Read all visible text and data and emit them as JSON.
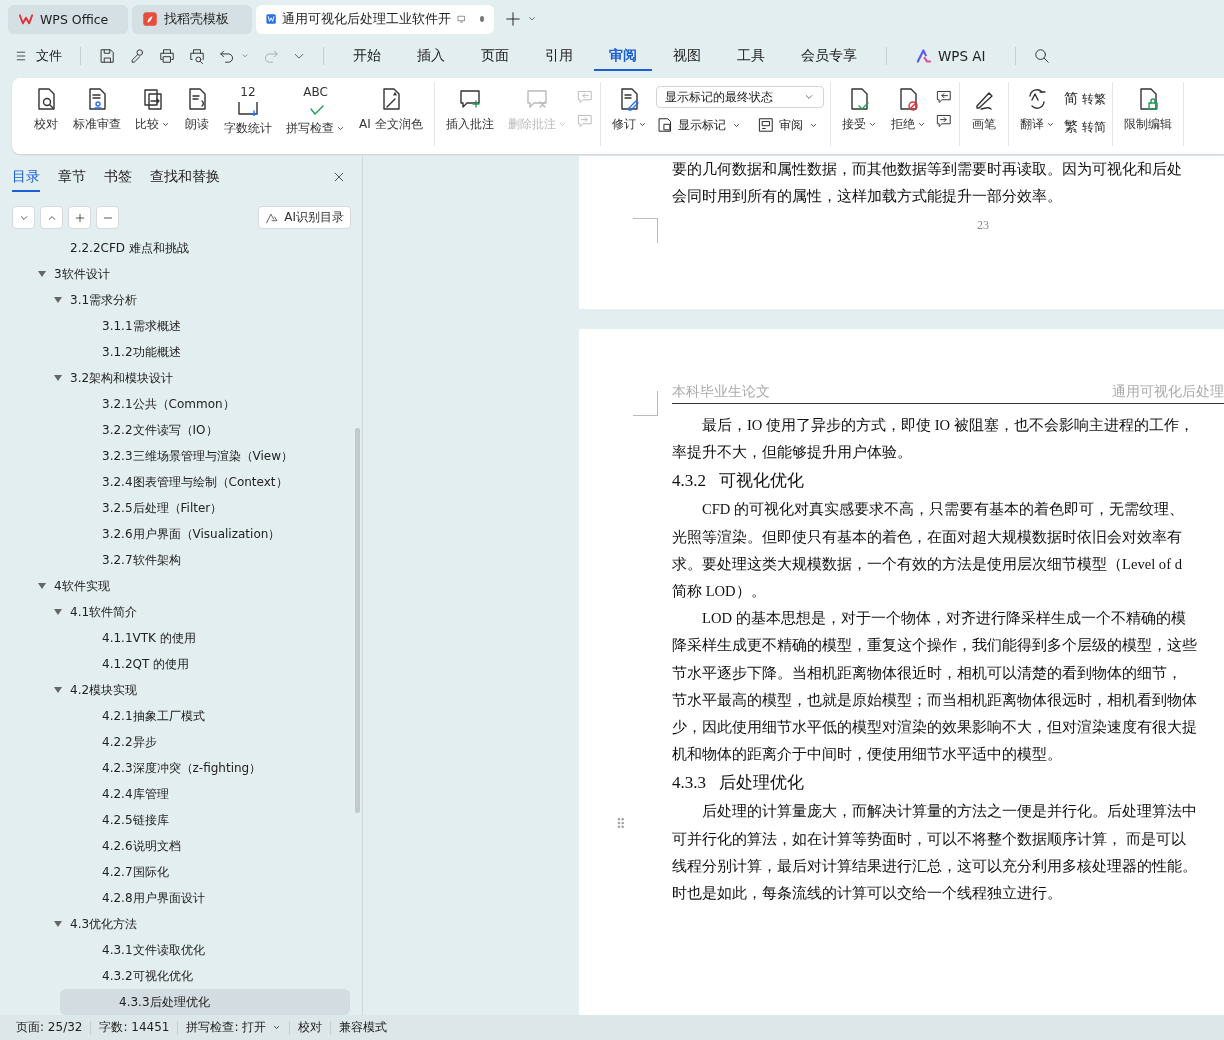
{
  "tabs": [
    {
      "label": "WPS Office",
      "selected": false
    },
    {
      "label": "找稻壳模板",
      "selected": false
    },
    {
      "label": "通用可视化后处理工业软件开",
      "selected": true,
      "unsaved": true
    }
  ],
  "menu": {
    "file": "文件",
    "tabs": [
      {
        "label": "开始",
        "selected": false
      },
      {
        "label": "插入",
        "selected": false
      },
      {
        "label": "页面",
        "selected": false
      },
      {
        "label": "引用",
        "selected": false
      },
      {
        "label": "审阅",
        "selected": true
      },
      {
        "label": "视图",
        "selected": false
      },
      {
        "label": "工具",
        "selected": false
      },
      {
        "label": "会员专享",
        "selected": false
      }
    ],
    "ai": "WPS AI"
  },
  "ribbon": [
    {
      "items": [
        {
          "kind": "large",
          "label": "校对",
          "dropdown": false,
          "disabled": false
        },
        {
          "kind": "large",
          "label": "标准审查",
          "dropdown": false,
          "disabled": false
        },
        {
          "kind": "large",
          "label": "比较",
          "dropdown": true,
          "disabled": false
        },
        {
          "kind": "large",
          "label": "朗读",
          "dropdown": false,
          "disabled": false
        },
        {
          "kind": "large",
          "label": "字数统计",
          "icon_text": "12",
          "dropdown": false,
          "disabled": false
        },
        {
          "kind": "large",
          "label": "拼写检查",
          "icon_text": "ABC",
          "dropdown": true,
          "disabled": false
        },
        {
          "kind": "large",
          "label": "AI 全文润色",
          "dropdown": false,
          "disabled": false
        }
      ]
    },
    {
      "items": [
        {
          "kind": "large",
          "label": "插入批注",
          "dropdown": false,
          "disabled": false
        },
        {
          "kind": "large",
          "label": "删除批注",
          "dropdown": true,
          "disabled": true
        },
        {
          "kind": "icon-pair",
          "disabled": true
        }
      ]
    },
    {
      "items": [
        {
          "kind": "large",
          "label": "修订",
          "dropdown": true,
          "disabled": false
        },
        {
          "kind": "select",
          "value": "显示标记的最终状态",
          "buttons": [
            {
              "label": "显示标记",
              "dropdown": true
            },
            {
              "label": "审阅",
              "dropdown": true
            }
          ]
        }
      ]
    },
    {
      "items": [
        {
          "kind": "large",
          "label": "接受",
          "dropdown": true,
          "disabled": false
        },
        {
          "kind": "large",
          "label": "拒绝",
          "dropdown": true,
          "disabled": false
        },
        {
          "kind": "icon-pair",
          "disabled": false
        }
      ]
    },
    {
      "items": [
        {
          "kind": "large",
          "label": "画笔",
          "dropdown": false,
          "disabled": false
        }
      ]
    },
    {
      "items": [
        {
          "kind": "large",
          "label": "翻译",
          "dropdown": true,
          "disabled": false
        },
        {
          "kind": "small-pair",
          "buttons": [
            {
              "glyph": "简",
              "label": "转繁"
            },
            {
              "glyph": "繁",
              "label": "转简"
            }
          ]
        }
      ]
    },
    {
      "items": [
        {
          "kind": "large",
          "label": "限制编辑",
          "dropdown": false,
          "disabled": false
        }
      ]
    }
  ],
  "sidebar": {
    "tabs": [
      {
        "label": "目录",
        "selected": true
      },
      {
        "label": "章节",
        "selected": false
      },
      {
        "label": "书签",
        "selected": false
      },
      {
        "label": "查找和替换",
        "selected": false
      }
    ],
    "ai_button": "AI识别目录",
    "toc": [
      {
        "label": "2.2.2CFD 难点和挑战",
        "selected": false
      },
      {
        "label": "3软件设计",
        "expanded": true,
        "selected": false,
        "children": [
          {
            "label": "3.1需求分析",
            "expanded": true,
            "selected": false,
            "children": [
              {
                "label": "3.1.1需求概述",
                "selected": false
              },
              {
                "label": "3.1.2功能概述",
                "selected": false
              }
            ]
          },
          {
            "label": "3.2架构和模块设计",
            "expanded": true,
            "selected": false,
            "children": [
              {
                "label": "3.2.1公共（Common）",
                "selected": false
              },
              {
                "label": "3.2.2文件读写（IO）",
                "selected": false
              },
              {
                "label": "3.2.3三维场景管理与渲染（View）",
                "selected": false
              },
              {
                "label": "3.2.4图表管理与绘制（Context）",
                "selected": false
              },
              {
                "label": "3.2.5后处理（Filter）",
                "selected": false
              },
              {
                "label": "3.2.6用户界面（Visualization）",
                "selected": false
              },
              {
                "label": "3.2.7软件架构",
                "selected": false
              }
            ]
          }
        ]
      },
      {
        "label": "4软件实现",
        "expanded": true,
        "selected": false,
        "children": [
          {
            "label": "4.1软件简介",
            "expanded": true,
            "selected": false,
            "children": [
              {
                "label": "4.1.1VTK 的使用",
                "selected": false
              },
              {
                "label": "4.1.2QT 的使用",
                "selected": false
              }
            ]
          },
          {
            "label": "4.2模块实现",
            "expanded": true,
            "selected": false,
            "children": [
              {
                "label": "4.2.1抽象工厂模式",
                "selected": false
              },
              {
                "label": "4.2.2异步",
                "selected": false
              },
              {
                "label": "4.2.3深度冲突（z-fighting）",
                "selected": false
              },
              {
                "label": "4.2.4库管理",
                "selected": false
              },
              {
                "label": "4.2.5链接库",
                "selected": false
              },
              {
                "label": "4.2.6说明文档",
                "selected": false
              },
              {
                "label": "4.2.7国际化",
                "selected": false
              },
              {
                "label": "4.2.8用户界面设计",
                "selected": false
              }
            ]
          },
          {
            "label": "4.3优化方法",
            "expanded": true,
            "selected": false,
            "children": [
              {
                "label": "4.3.1文件读取优化",
                "selected": false
              },
              {
                "label": "4.3.2可视化优化",
                "selected": false
              },
              {
                "label": "4.3.3后处理优化",
                "selected": true
              }
            ]
          }
        ]
      }
    ]
  },
  "document": {
    "page1": {
      "blocks": [
        {
          "kind": "paragraph",
          "indent": false,
          "lines": [
            "要的几何数据和属性数据，而其他数据等到需要时再读取。因为可视化和后处",
            "会同时用到所有的属性，这样加载方式能提升一部分效率。"
          ]
        }
      ],
      "page_number": "23"
    },
    "page2": {
      "header_left": "本科毕业生论文",
      "header_right": "通用可视化后处理",
      "blocks": [
        {
          "kind": "paragraph",
          "indent": true,
          "lines": [
            "最后，IO 使用了异步的方式，即使 IO 被阻塞，也不会影响主进程的工作，",
            "率提升不大，但能够提升用户体验。"
          ]
        },
        {
          "kind": "heading",
          "number": "4.3.2",
          "title": "可视化优化"
        },
        {
          "kind": "paragraph",
          "indent": true,
          "lines": [
            "CFD 的可视化对真实感要求不高，只需要有基本的着色即可，无需纹理、",
            "光照等渲染。但即使只有基本的着色，在面对超大规模数据时依旧会对效率有",
            "求。要处理这类大规模数据，一个有效的方法是使用层次细节模型（Level of d",
            "简称 LOD）。"
          ]
        },
        {
          "kind": "paragraph",
          "indent": true,
          "lines": [
            "LOD 的基本思想是，对于一个物体，对齐进行降采样生成一个不精确的模",
            "降采样生成更不精确的模型，重复这个操作，我们能得到多个层级的模型，这些",
            "节水平逐步下降。当相机距离物体很近时，相机可以清楚的看到物体的细节，",
            "节水平最高的模型，也就是原始模型；而当相机距离物体很远时，相机看到物体",
            "少，因此使用细节水平低的模型对渲染的效果影响不大，但对渲染速度有很大提",
            "机和物体的距离介于中间时，便使用细节水平适中的模型。"
          ]
        },
        {
          "kind": "heading",
          "number": "4.3.3",
          "title": "后处理优化"
        },
        {
          "kind": "paragraph",
          "indent": true,
          "lines": [
            "后处理的计算量庞大，而解决计算量的方法之一便是并行化。后处理算法中",
            "可并行化的算法，如在计算等势面时，可以不将整个数据顺序计算，  而是可以",
            "线程分别计算，最后对计算结果进行汇总，这可以充分利用多核处理器的性能。",
            "时也是如此，每条流线的计算可以交给一个线程独立进行。"
          ]
        }
      ]
    }
  },
  "status_bar": [
    {
      "label": "页面: 25/32",
      "dropdown": false
    },
    {
      "label": "字数: 14451",
      "dropdown": false
    },
    {
      "label": "拼写检查: 打开",
      "dropdown": true
    },
    {
      "label": "校对",
      "dropdown": false
    },
    {
      "label": "兼容模式",
      "dropdown": false
    }
  ]
}
